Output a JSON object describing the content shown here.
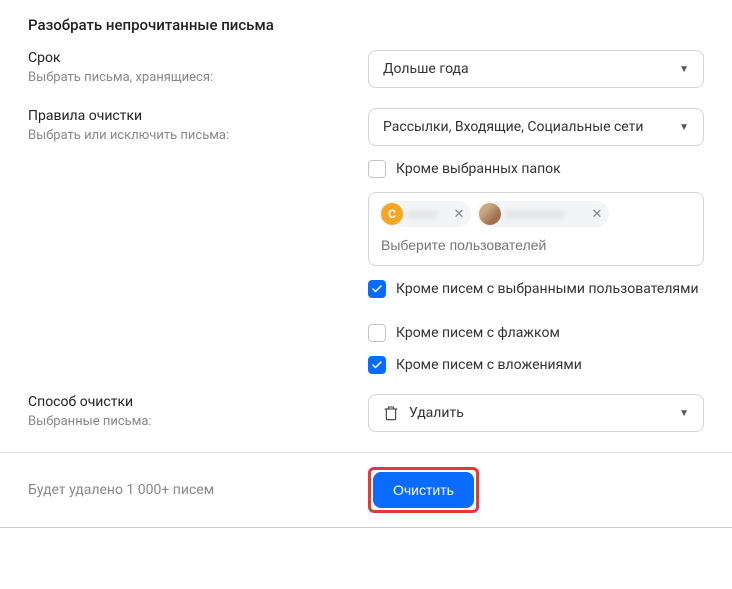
{
  "page_title": "Разобрать непрочитанные письма",
  "period": {
    "label": "Срок",
    "sub": "Выбрать письма, хранящиеся:",
    "value": "Дольше года"
  },
  "rules": {
    "label": "Правила очистки",
    "sub": "Выбрать или исключить письма:",
    "selectValue": "Рассылки, Входящие, Социальные сети",
    "excludeFolders": {
      "label": "Кроме выбранных папок",
      "checked": false
    },
    "userSelectPlaceholder": "Выберите пользователей",
    "excludeUsers": {
      "label": "Кроме писем с выбранными пользователями",
      "checked": true
    },
    "excludeFlagged": {
      "label": "Кроме писем с флажком",
      "checked": false
    },
    "excludeAttachments": {
      "label": "Кроме писем с вложениями",
      "checked": true
    },
    "chips": [
      {
        "initial": "С",
        "avatar": "orange",
        "labelClass": "short"
      },
      {
        "initial": "",
        "avatar": "photo",
        "labelClass": "long"
      }
    ]
  },
  "method": {
    "label": "Способ очистки",
    "sub": "Выбранные письма:",
    "value": "Удалить"
  },
  "footer": {
    "summary": "Будет удалено 1 000+ писем",
    "action": "Очистить"
  }
}
